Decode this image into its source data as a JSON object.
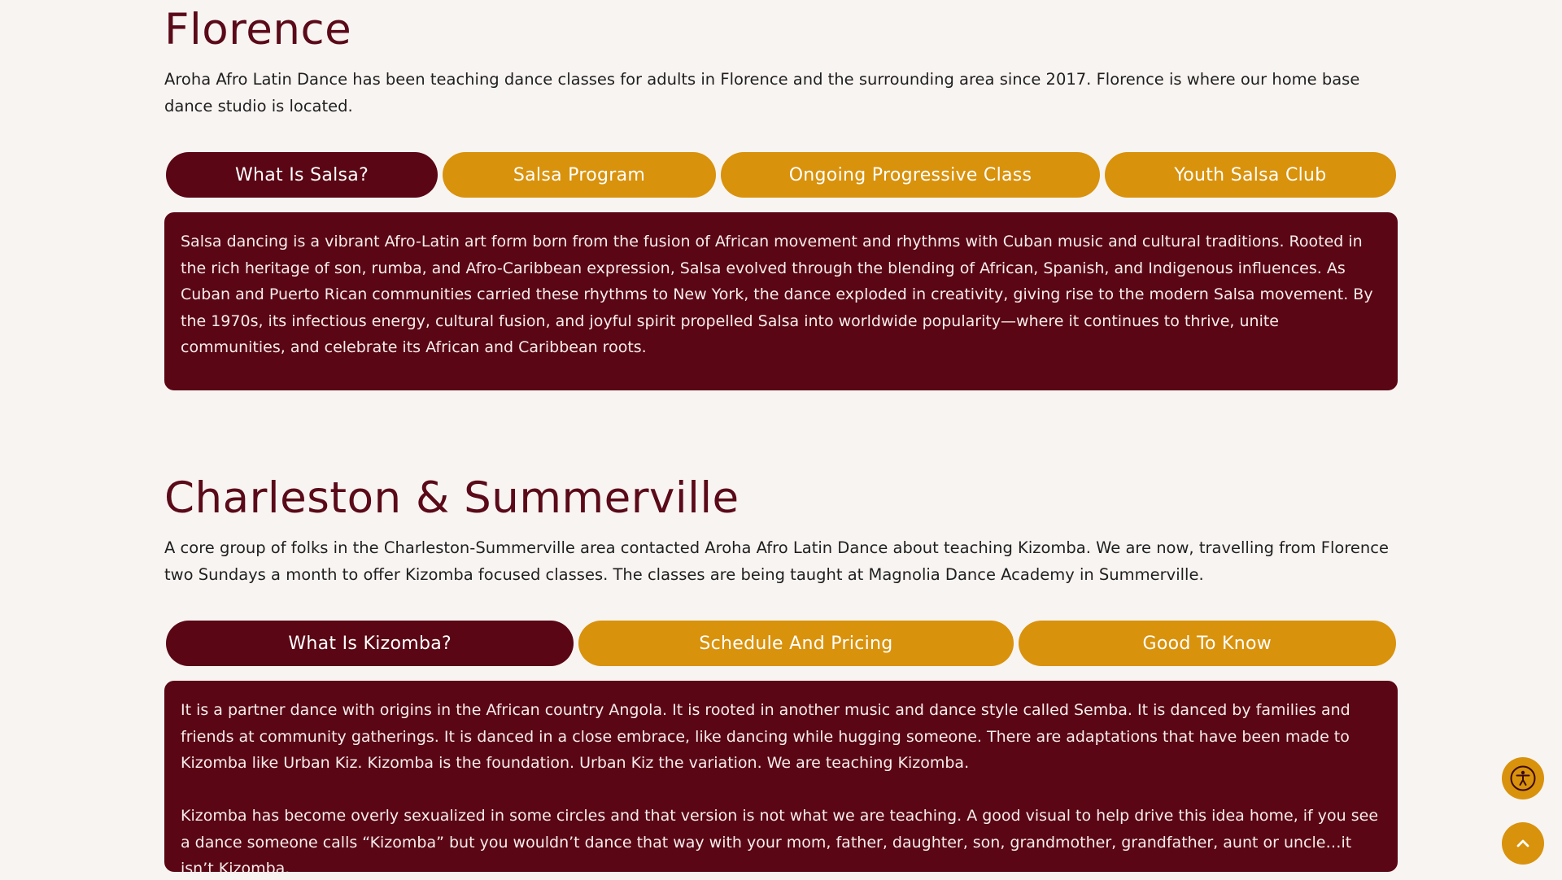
{
  "florence": {
    "title": "Florence",
    "intro": "Aroha Afro Latin Dance has been teaching dance classes for adults in Florence and the surrounding area since 2017. Florence is where our home base dance studio is located.",
    "tabs": [
      {
        "label": "What Is Salsa?"
      },
      {
        "label": "Salsa Program"
      },
      {
        "label": "Ongoing Progressive Class"
      },
      {
        "label": "Youth Salsa Club"
      }
    ],
    "panel_text": "Salsa dancing is a vibrant Afro-Latin art form born from the fusion of African movement and rhythms with Cuban music and cultural traditions. Rooted in the rich heritage of son, rumba, and Afro-Caribbean expression, Salsa evolved through the blending of African, Spanish, and Indigenous influences. As Cuban and Puerto Rican communities carried these rhythms to New York, the dance exploded in creativity, giving rise to the modern Salsa movement. By the 1970s, its infectious energy, cultural fusion, and joyful spirit propelled Salsa into worldwide popularity—where it continues to thrive, unite communities, and celebrate its African and Caribbean roots."
  },
  "charleston": {
    "title": "Charleston & Summerville",
    "intro": "A core group of folks in the Charleston-Summerville area contacted Aroha Afro Latin Dance about teaching Kizomba. We are now, travelling from Florence two Sundays a month to offer Kizomba focused classes. The classes are being taught at Magnolia Dance Academy in Summerville.",
    "tabs": [
      {
        "label": "What Is Kizomba?"
      },
      {
        "label": "Schedule And Pricing"
      },
      {
        "label": "Good To Know"
      }
    ],
    "panel_paragraphs": [
      "It is a partner dance with origins in the African country Angola. It is rooted in another music and dance style called Semba. It is danced by families and friends at community gatherings. It is danced in a close embrace, like dancing while hugging someone. There are adaptations that have been made to Kizomba like Urban Kiz. Kizomba is the foundation. Urban Kiz the variation. We are teaching Kizomba.",
      "Kizomba has become overly sexualized in some circles and that version is not what we are teaching. A good visual to help drive this idea home, if you see a dance someone calls “Kizomba” but you wouldn’t dance that way with your mom, father, daughter, son, grandmother, grandfather, aunt or uncle…it isn’t Kizomba."
    ]
  },
  "floating": {
    "accessibility_icon": "accessibility-icon",
    "scroll_top_icon": "chevron-up-icon"
  },
  "colors": {
    "brand_dark": "#5a0614",
    "accent": "#d9920c",
    "background": "#f8f4f2"
  }
}
